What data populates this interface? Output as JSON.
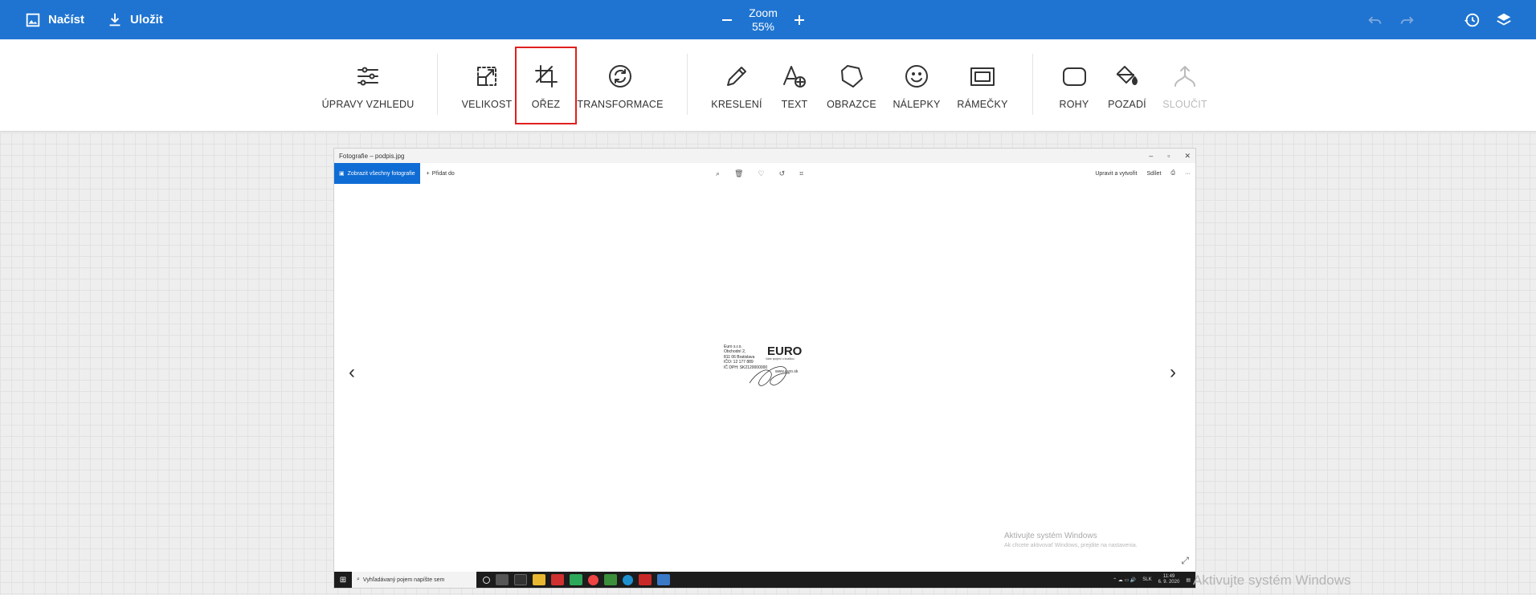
{
  "topbar": {
    "load_label": "Načíst",
    "save_label": "Uložit",
    "zoom_title": "Zoom",
    "zoom_value": "55%"
  },
  "toolbar": {
    "tools": [
      {
        "label": "ÚPRAVY VZHLEDU",
        "icon": "sliders-icon"
      },
      {
        "label": "VELIKOST",
        "icon": "resize-icon"
      },
      {
        "label": "OŘEZ",
        "icon": "crop-icon",
        "selected": true
      },
      {
        "label": "TRANSFORMACE",
        "icon": "rotate-icon"
      },
      {
        "label": "KRESLENÍ",
        "icon": "pencil-icon"
      },
      {
        "label": "TEXT",
        "icon": "text-add-icon"
      },
      {
        "label": "OBRAZCE",
        "icon": "shape-icon"
      },
      {
        "label": "NÁLEPKY",
        "icon": "smiley-icon"
      },
      {
        "label": "RÁMEČKY",
        "icon": "frame-icon"
      },
      {
        "label": "ROHY",
        "icon": "rounded-corners-icon"
      },
      {
        "label": "POZADÍ",
        "icon": "paint-bucket-icon"
      },
      {
        "label": "SLOUČIT",
        "icon": "merge-icon",
        "disabled": true
      }
    ]
  },
  "photo": {
    "window_title": "Fotografie – podpis.jpg",
    "all_photos": "Zobrazit všechny fotografie",
    "add_to": "Přidat do",
    "edit_create": "Upravit a vytvořit",
    "share": "Sdílet",
    "stamp_lines": [
      "Euro s.r.o.",
      "Obchodní 2,",
      "811 06 Bratislava",
      "IČO: 12 177 889",
      "IČ DPH: SK2120000000"
    ],
    "stamp_logo": "EURO",
    "stamp_subtitle": "Vaše spojení s kvalitou",
    "stamp_www": "www.euro.sk",
    "activation_title": "Aktivujte systém Windows",
    "activation_sub": "Ak chcete aktivovať Windows, prejdite na nastavenia.",
    "search_placeholder": "Vyhľadávaný pojem napíšte sem",
    "tray_lang": "SLK",
    "clock_time": "11:49",
    "clock_date": "6. 9. 2020"
  },
  "watermark": "Aktivujte systém Windows",
  "colors": {
    "topbar": "#1f74d1",
    "selected_border": "#e02020",
    "windows_accent": "#0f6cd4"
  }
}
